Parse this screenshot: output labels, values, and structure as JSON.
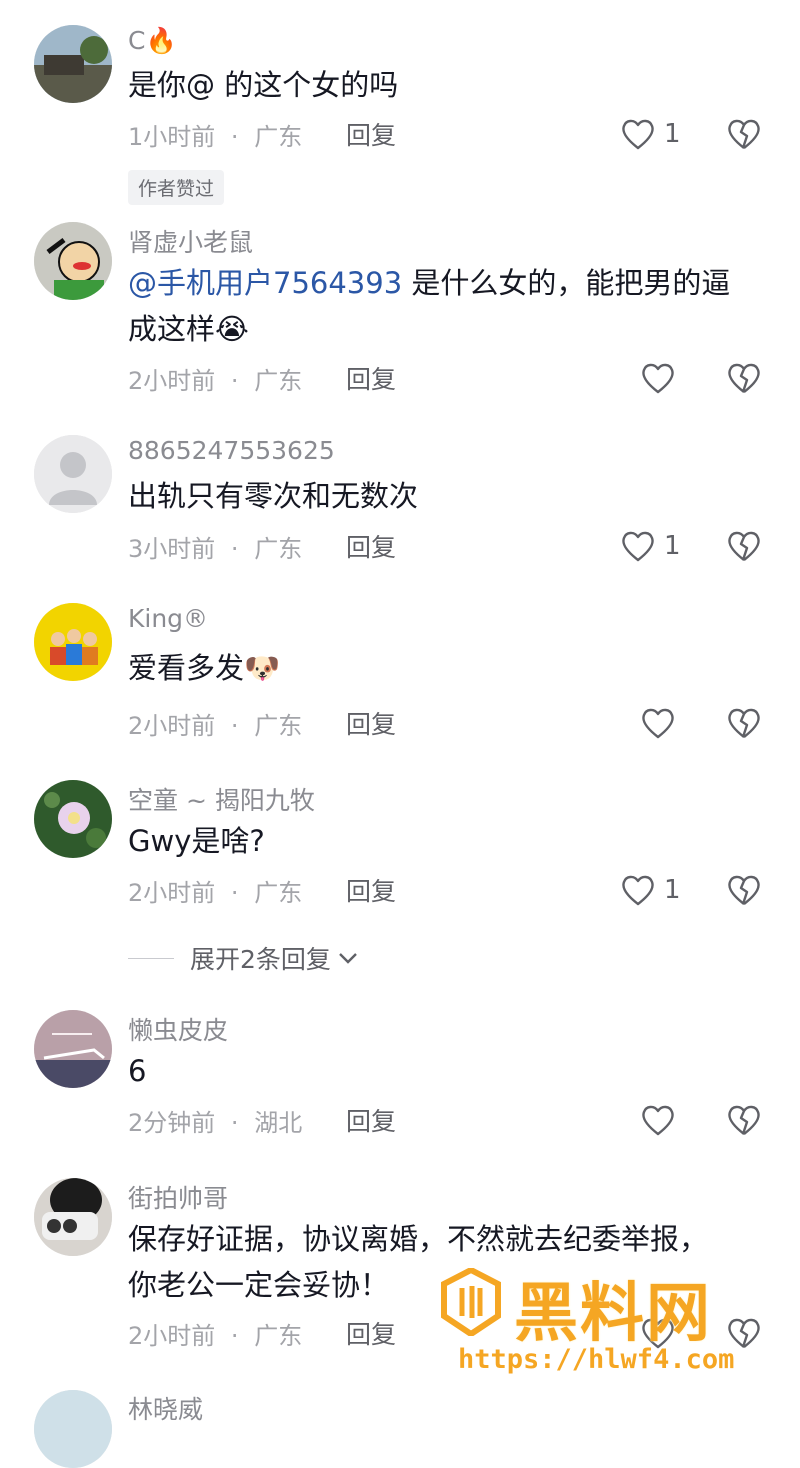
{
  "comments": [
    {
      "username": "C🔥",
      "text": "是你@ 的这个女的吗",
      "time": "1小时前",
      "location": "广东",
      "reply": "回复",
      "likes": "1",
      "badge": "作者赞过"
    },
    {
      "username": "肾虚小老鼠",
      "mention": "@手机用户7564393",
      "text": " 是什么女的，能把男的逼成这样😭",
      "time": "2小时前",
      "location": "广东",
      "reply": "回复",
      "likes": ""
    },
    {
      "username": "8865247553625",
      "text": "出轨只有零次和无数次",
      "time": "3小时前",
      "location": "广东",
      "reply": "回复",
      "likes": "1"
    },
    {
      "username": "King®",
      "text": "爱看多发🐶",
      "time": "2小时前",
      "location": "广东",
      "reply": "回复",
      "likes": ""
    },
    {
      "username": "空童 ~ 揭阳九牧",
      "text": "Gwy是啥?",
      "time": "2小时前",
      "location": "广东",
      "reply": "回复",
      "likes": "1",
      "expand": "展开2条回复"
    },
    {
      "username": "懒虫皮皮",
      "text": "6",
      "time": "2分钟前",
      "location": "湖北",
      "reply": "回复",
      "likes": ""
    },
    {
      "username": "街拍帅哥",
      "text": "保存好证据，协议离婚，不然就去纪委举报，你老公一定会妥协！",
      "time": "2小时前",
      "location": "广东",
      "reply": "回复",
      "likes": ""
    },
    {
      "username": "林晓威"
    }
  ],
  "meta_separator": "·",
  "watermark": {
    "title": "黑料网",
    "url": "https://hlwf4.com"
  },
  "colors": {
    "mention": "#2b57a6",
    "watermark": "#f5a623"
  }
}
